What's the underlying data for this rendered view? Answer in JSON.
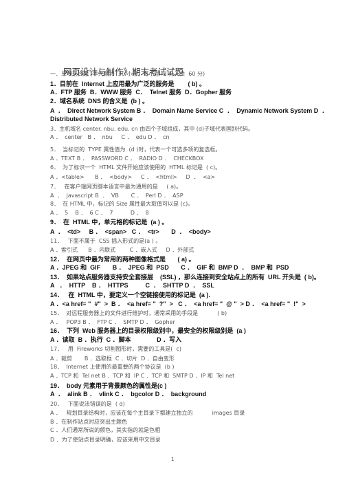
{
  "title": "网页设计与制作》期末考试试题",
  "lines": [
    "一．单项选择题 (本大题共  30 小题，每小题  2 分，共  60 分)",
    "1．目前在  Internet 上应用最为广泛的服务是        ( b) 。",
    "A．FTP 服务  B．WWW 服务  C．  Telnet 服务  D．Gopher 服务",
    "2．域名系统  DNS 的含义是  (b ) 。",
    "A  ．  Direct Network System B ．  Domain Name Service C  ．  Dynamic Network System D  ．",
    "Distributed Network Service",
    "3．主机域名 center. nbu. edu. cn 由四个子域组成，其中 (d)子域代表国别代码。",
    "A ．  center   B ．  nbu     C ．  edu D ．  cn",
    "5．  当标记的  TYPE 属性值为  (d )时，代表一个可选多项的复选框。",
    "A ．TEXT B ．  PASSWORD C ．  RADIO D ．  CHECKBOX",
    "6．  为了标识一个  HTML 文件开始应该使用的  HTML 标记是  ( c)。",
    "A ．<table>      B ．  <body>     C ．  <html>     D  ．  <a>",
    "7．   在客户端网页脚本语言中最为通用的是     ( a)。",
    "A  ．  javascript B  ．  VB       C ．  Perl D ．  ASP",
    "8．  在 HTML 中，标记的 Size 属性最大取值可以是 (c)。",
    "A ．  5    B ．  6 C ．  7          D ．  8",
    "9．  在  HTML 中，单元格的标记是  (a ) 。",
    "A  ．  <td>     B ．  <span>   C ．  <tr>       D  ．  <body>",
    "11．   下面不属于  CSS 插入形式的是(a ) 。",
    "A ．索引式      B ．内联式        C ．嵌入式     D ．外部式",
    "12．  在网页中最为常用的两种图像格式是       ( a) 。",
    "A ．JPEG 和  GIF       B ．  JPEG 和  PSD       C ．  GIF 和  BMP D  ．  BMP 和  PSD",
    "13．  如果站点服务器支持安全套接层    (SSL) ，那么连接到安全站点上的所有  URL 开头是  ( b)。",
    "A   ．  HTTP    B ．  HTTPS          C  ．  SHTTP D  ．  SSL",
    "14．   在  HTML 中，要定义一个空链接使用的标记是  (a ).",
    "A ．<a href= \"  #\"  >  B ．  <a href= \"  ?\"  >   C ．  <a href= \"  @ \"  > D ．  <a href= \"  !\"  >",
    "15．  对远程服务器上的文件进行维护时，通常采用的手段是           ( b)",
    "A ．   POP3 B ．  FTP C ．  SMTP D ．  Gopher",
    "16．  下列  Web 服务器上的目录权限级别中，最安全的权限级别是  (a )",
    "A ．读取  B ．执行  C ．脚本               D ．写入",
    "17．   用  Fireworks 切割图形时，需要的工具是(  c)",
    "A ．裁剪       B ．选取框  C ．切片  D ．自由变形",
    "18．  Internet 上使用的最重要的两个协议是  (b )",
    "A ．TCP 和  Tel net B ．TCP 和  IP C ．TCP 和  SMTP D ．IP 和  Tel net",
    "19．  body 元素用于背景颜色的属性是(c )",
    "A  ．  alink B ．  vlink C ．  bgcolor D ．  background",
    "20．   下面说法错误的是  ( d)",
    "A ．   规划目录结构时，应该在每个主目录下都建立独立的           images 目录",
    "B ．在制作站点时应突出主题色",
    "C ．人们通常所说的颜色，其实指的就是色相",
    "D ．为了使站点目录明确，应该采用中文目录"
  ],
  "page_number": "1"
}
